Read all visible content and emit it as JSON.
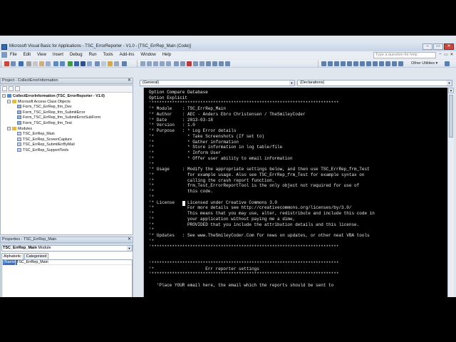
{
  "window": {
    "title": "Microsoft Visual Basic for Applications - TSC_ErrorReporter - V1.0 - [TSC_ErrRep_Main (Code)]",
    "controls": [
      "–",
      "▭",
      "✕"
    ]
  },
  "menu": {
    "items": [
      "File",
      "Edit",
      "View",
      "Insert",
      "Debug",
      "Run",
      "Tools",
      "Add-Ins",
      "Window",
      "Help"
    ],
    "help_placeholder": "Type a question for help",
    "mdi_controls": [
      "–",
      "▭",
      "✕"
    ]
  },
  "toolbar": {
    "other_utilities": "Other Utilities ▾"
  },
  "project": {
    "title": "Project - CollectErrorInformation",
    "close": "✕",
    "root": "CollectErrorInformation (TSC_ErrorReporter - V1.0)",
    "folder_access": "Microsoft Access Class Objects",
    "forms": [
      "Form_TSC_ErrRep_frm_Dev",
      "Form_TSC_ErrRep_frm_SubmitError",
      "Form_TSC_ErrRep_frm_SubmitErrorSubForm",
      "Form_TSC_ErrRep_frm_Test"
    ],
    "folder_modules": "Modules",
    "modules": [
      "TSC_ErrRep_Main",
      "TSC_ErrRep_ScreenCapture",
      "TSC_ErrRep_SubmitErrByMail",
      "TSC_ErrRep_SupportTools"
    ]
  },
  "properties": {
    "title": "Properties - TSC_ErrRep_Main",
    "close": "✕",
    "object_name": "TSC_ErrRep_Main",
    "object_type": "Module",
    "tabs": [
      "Alphabetic",
      "Categorized"
    ],
    "row_key": "(Name)",
    "row_value": "TSC_ErrRep_Main"
  },
  "code": {
    "object_dropdown": "(General)",
    "procedure_dropdown": "(Declarations)",
    "lines": [
      "Option Compare Database",
      "Option Explicit",
      "'*************************************************************************",
      "'* Module    : TSC_ErrRep_Main",
      "'* Author    : AEC - Anders Ebro Christensen / TheSmileyCoder",
      "'* Date      : 2013-03-18",
      "'* Version   : 1.0",
      "'* Purpose   : * Log Error details",
      "'*             * Take Screenshots (If set to)",
      "'*             * Gather information",
      "'*             * Store information in log table/file",
      "'*             * Inform User",
      "'*             * Offer user ability to email information",
      "'*",
      "'* Usage     : Modify the appropriate settings below, and then use TSC_ErrRep_frm_Test",
      "'*             for example usage. Also see TSC_ErrRep_frm_Test for example syntax on",
      "'*             calling the crash report function.",
      "'*             frm_Test_ErrorReportTool is the only object not required for use of",
      "'*             this code.",
      "'*",
      "'* License   : Licensed under Creative Commons 3.0",
      "'*             For more details see http://creativecommons.org/licenses/by/3.0/",
      "'*             This means that you may use, alter, redistribute and include this code in",
      "'*             your application without paying me a dime,",
      "'*             PROVIDED that you include the attribution details and this license.",
      "'*",
      "'* Updates   : See www.TheSmileyCoder.Com for news on updates, or other neat VBA tools",
      "'*",
      "'*************************************************************************",
      "",
      "",
      "'*************************************************************************",
      "'*                    Err reporter settings",
      "'*************************************************************************",
      "",
      "   'Place YOUR email here, the email which the reports should be sent to"
    ]
  }
}
